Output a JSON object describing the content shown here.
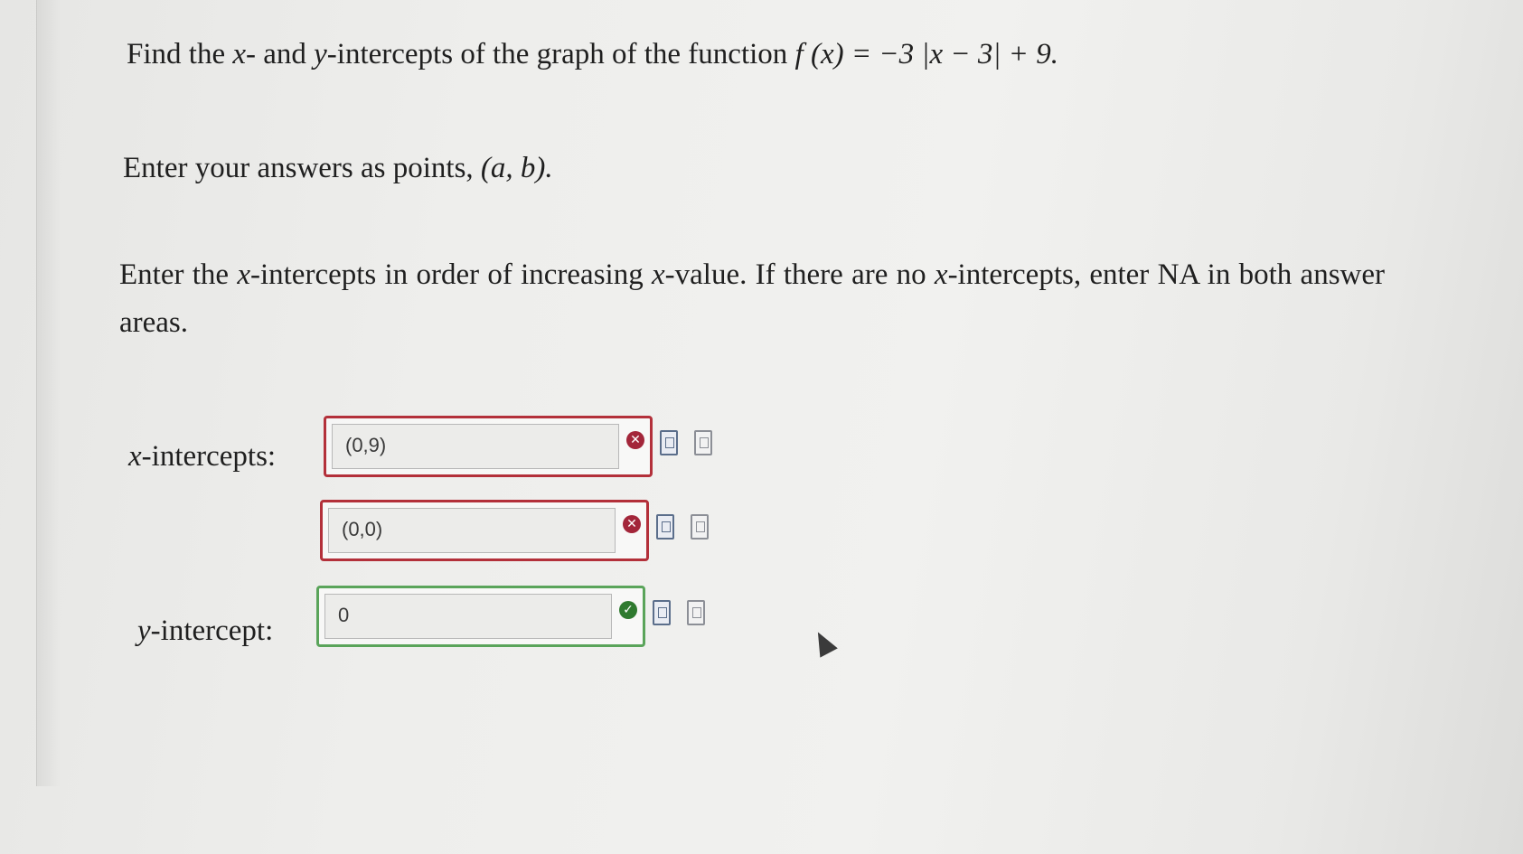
{
  "question": {
    "line1_prefix": "Find the ",
    "line1_x": "x",
    "line1_mid1": "- and ",
    "line1_y": "y",
    "line1_mid2": "-intercepts of the graph of the function ",
    "line1_function": "f (x) = −3 |x − 3| + 9.",
    "line2_prefix": "Enter your answers as points, ",
    "line2_point": "(a, b).",
    "line3_text1": "Enter the ",
    "line3_x1": "x",
    "line3_text2": "-intercepts in order of increasing ",
    "line3_x2": "x",
    "line3_text3": "-value. If there are no ",
    "line3_x3": "x",
    "line3_text4": "-intercepts, enter NA in both answer areas."
  },
  "answers": {
    "x_label_var": "x",
    "x_label_rest": "-intercepts:",
    "x1_value": "(0,9)",
    "x2_value": "(0,0)",
    "y_label_var": "y",
    "y_label_rest": "-intercept:",
    "y_value": "0",
    "x1_status": "incorrect",
    "x2_status": "incorrect",
    "y_status": "correct"
  },
  "icons": {
    "incorrect": "x-circle-icon",
    "correct": "check-circle-icon",
    "preview": "preview-document-icon",
    "help": "help-document-icon"
  },
  "colors": {
    "incorrect_border": "#b3303a",
    "correct_border": "#5aa45a"
  }
}
